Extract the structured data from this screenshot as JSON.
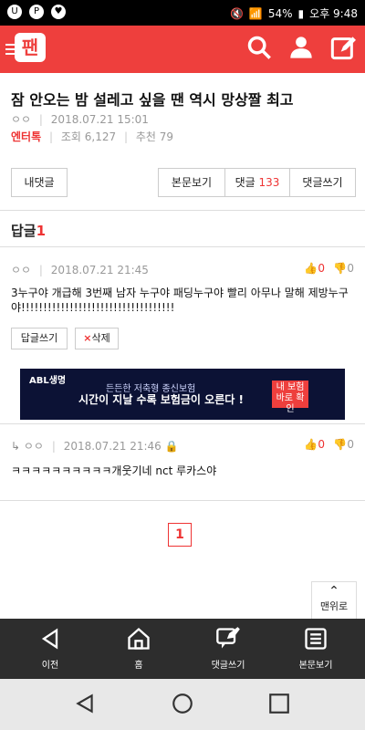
{
  "status_bar": {
    "battery": "54%",
    "time": "오후 9:48"
  },
  "header": {
    "logo_text": "팬"
  },
  "article": {
    "title": "잠 안오는 밤 설레고 싶을 땐 역시 망상짤 최고",
    "author": "ㅇㅇ",
    "date": "2018.07.21 15:01",
    "category": "엔터톡",
    "views_label": "조회",
    "views": "6,127",
    "recommend_label": "추천",
    "recommend": "79"
  },
  "buttons": {
    "my_comment": "내댓글",
    "view_post": "본문보기",
    "comments_label": "댓글",
    "comments_count": "133",
    "write_comment": "댓글쓰기"
  },
  "replies": {
    "label": "답글",
    "count": "1"
  },
  "comments": [
    {
      "author": "ㅇㅇ",
      "date": "2018.07.21 21:45",
      "up": "0",
      "down": "0",
      "text": "3누구야 개급해 3번째 남자 누구야 패딩누구야 빨리 아무나 말해 제방누구야!!!!!!!!!!!!!!!!!!!!!!!!!!!!!!!!!!!",
      "reply_btn": "답글쓰기",
      "delete_btn": "삭제"
    },
    {
      "author": "ㅇㅇ",
      "date": "2018.07.21 21:46",
      "up": "0",
      "down": "0",
      "text": "ㅋㅋㅋㅋㅋㅋㅋㅋㅋㅋ개웃기네 nct 루카스야"
    }
  ],
  "ad": {
    "brand": "ABL생명",
    "line1": "든든한 저축형 종신보험",
    "line2": "시간이 지날 수록 보험금이 오른다 !",
    "cta": "내 보험 바로 확인"
  },
  "pagination": {
    "current": "1"
  },
  "to_top": "맨위로",
  "bottom_nav": {
    "prev": "이전",
    "home": "홈",
    "write": "댓글쓰기",
    "view": "본문보기"
  }
}
